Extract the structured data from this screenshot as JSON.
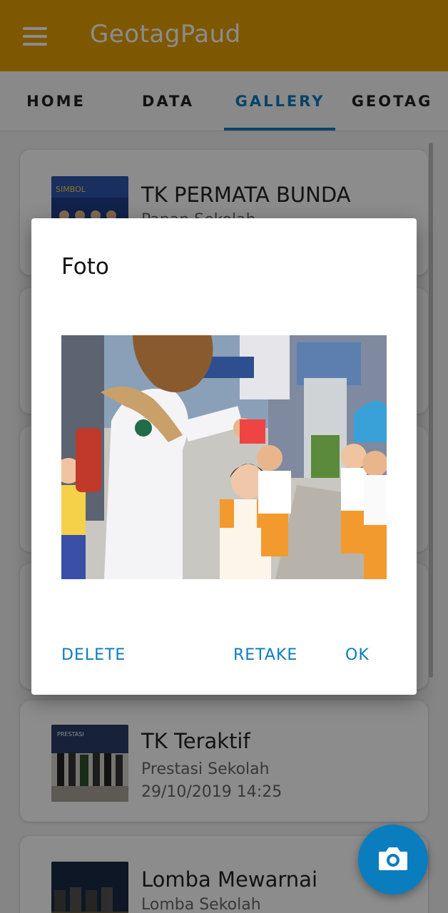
{
  "app": {
    "title": "GeotagPaud"
  },
  "tabs": [
    {
      "label": "HOME"
    },
    {
      "label": "DATA"
    },
    {
      "label": "GALLERY"
    },
    {
      "label": "GEOTAG"
    }
  ],
  "gallery": {
    "items": [
      {
        "title": "TK PERMATA BUNDA",
        "subtitle": "Papan Sekolah",
        "date": ""
      },
      {
        "title": "",
        "subtitle": "",
        "date": ""
      },
      {
        "title": "",
        "subtitle": "",
        "date": ""
      },
      {
        "title": "",
        "subtitle": "",
        "date": ""
      },
      {
        "title": "TK Teraktif",
        "subtitle": "Prestasi Sekolah",
        "date": "29/10/2019 14:25"
      },
      {
        "title": "Lomba Mewarnai",
        "subtitle": "Lomba Sekolah",
        "date": ""
      }
    ]
  },
  "dialog": {
    "title": "Foto",
    "delete_label": "DELETE",
    "retake_label": "RETAKE",
    "ok_label": "OK"
  },
  "fab": {
    "icon": "camera-icon"
  },
  "colors": {
    "primary": "#E6A000",
    "accent": "#0a7dbf"
  }
}
